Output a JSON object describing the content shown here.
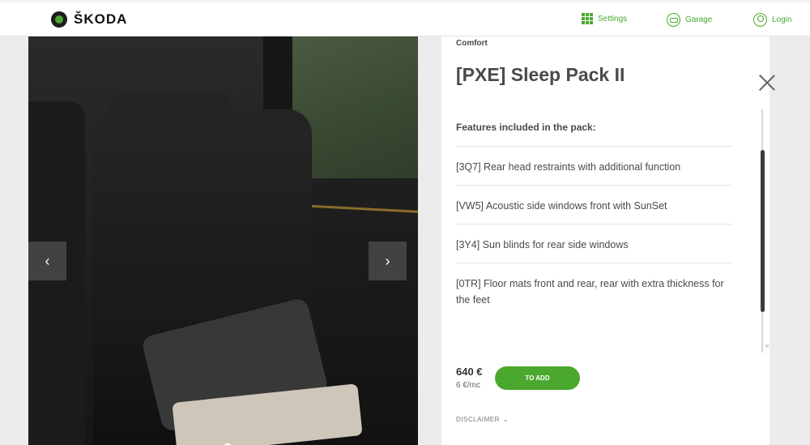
{
  "header": {
    "brand": "ŠKODA",
    "nav": {
      "settings": "Settings",
      "garage": "Garage",
      "login": "Login"
    }
  },
  "gallery": {
    "prev_icon": "‹",
    "next_icon": "›",
    "slide_count": 5,
    "active_slide": 1
  },
  "panel": {
    "category": "Comfort",
    "title": "[PXE] Sleep Pack II",
    "features_heading": "Features included in the pack:",
    "features": [
      "[3Q7] Rear head restraints with additional function",
      "[VW5] Acoustic side windows front with SunSet",
      "[3Y4] Sun blinds for rear side windows",
      "[0TR] Floor mats front and rear, rear with extra thickness for the feet"
    ],
    "price": "640 €",
    "price_monthly": "6 €/mc",
    "add_button": "TO ADD",
    "disclaimer": "DISCLAIMER",
    "disclaimer_icon": "⌄"
  },
  "colors": {
    "accent": "#4ba82e",
    "panel_bg": "#ffffff",
    "page_bg": "#ececec"
  },
  "icons": {
    "logo": "skoda-logo-icon",
    "settings": "grid-icon",
    "garage": "car-icon",
    "login": "user-icon",
    "close": "close-icon"
  }
}
